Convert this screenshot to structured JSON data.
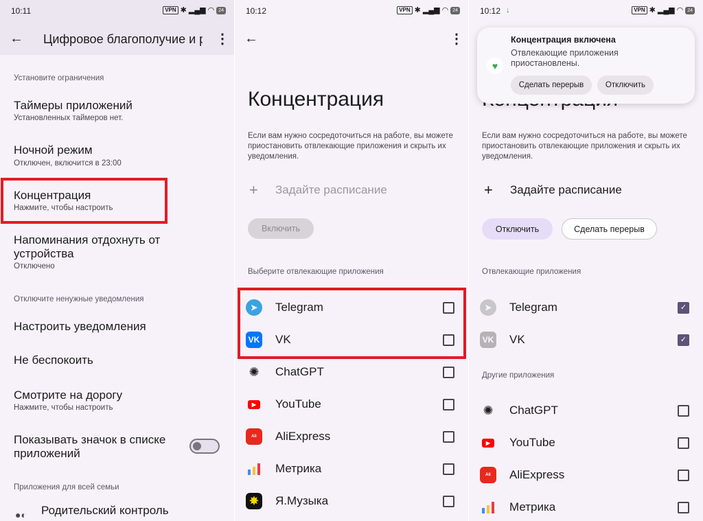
{
  "screen1": {
    "time": "10:11",
    "status_vpn": "VPN",
    "battery": "24",
    "title": "Цифровое благополучие и р...",
    "section_limits": "Установите ограничения",
    "items": [
      {
        "title": "Таймеры приложений",
        "sub": "Установленных таймеров нет."
      },
      {
        "title": "Ночной режим",
        "sub": "Отключен, включится в 23:00"
      },
      {
        "title": "Концентрация",
        "sub": "Нажмите, чтобы настроить"
      },
      {
        "title": "Напоминания отдохнуть от устройства",
        "sub": "Отключено"
      }
    ],
    "section_notifications": "Отключите ненужные уведомления",
    "items2": [
      {
        "title": "Настроить уведомления"
      },
      {
        "title": "Не беспокоить"
      },
      {
        "title": "Смотрите на дорогу",
        "sub": "Нажмите, чтобы настроить"
      },
      {
        "title": "Показывать значок в списке приложений"
      }
    ],
    "section_family": "Приложения для всей семьи",
    "parental": "Родительский контроль"
  },
  "screen2": {
    "time": "10:12",
    "status_vpn": "VPN",
    "battery": "24",
    "title": "Концентрация",
    "description": "Если вам нужно сосредоточиться на работе, вы можете приостановить отвлекающие приложения и скрыть их уведомления.",
    "schedule": "Задайте расписание",
    "enable_button": "Включить",
    "list_header": "Выберите отвлекающие приложения",
    "apps": [
      {
        "name": "Telegram",
        "icon": "telegram-icon",
        "checked": false
      },
      {
        "name": "VK",
        "icon": "vk-icon",
        "checked": false
      },
      {
        "name": "ChatGPT",
        "icon": "chatgpt-icon",
        "checked": false
      },
      {
        "name": "YouTube",
        "icon": "youtube-icon",
        "checked": false
      },
      {
        "name": "AliExpress",
        "icon": "aliexpress-icon",
        "checked": false
      },
      {
        "name": "Метрика",
        "icon": "metrika-icon",
        "checked": false
      },
      {
        "name": "Я.Музыка",
        "icon": "yandex-music-icon",
        "checked": false
      }
    ]
  },
  "screen3": {
    "time": "10:12",
    "status_vpn": "VPN",
    "battery": "24",
    "notification": {
      "title": "Концентрация включена",
      "text": "Отвлекающие приложения приостановлены.",
      "break_button": "Сделать перерыв",
      "off_button": "Отключить"
    },
    "title": "Концентрация",
    "description": "Если вам нужно сосредоточиться на работе, вы можете приостановить отвлекающие приложения и скрыть их уведомления.",
    "schedule": "Задайте расписание",
    "off_button": "Отключить",
    "break_button": "Сделать перерыв",
    "distracting_header": "Отвлекающие приложения",
    "distracting": [
      {
        "name": "Telegram",
        "checked": true
      },
      {
        "name": "VK",
        "checked": true
      }
    ],
    "other_header": "Другие приложения",
    "other": [
      {
        "name": "ChatGPT",
        "checked": false
      },
      {
        "name": "YouTube",
        "checked": false
      },
      {
        "name": "AliExpress",
        "checked": false
      },
      {
        "name": "Метрика",
        "checked": false
      }
    ]
  },
  "colors": {
    "highlight_red": "#e21b23",
    "accent_purple": "#5d5277",
    "background": "#f7f2fa"
  }
}
